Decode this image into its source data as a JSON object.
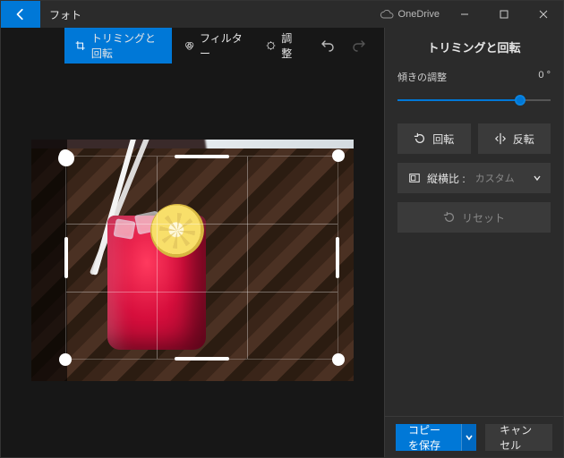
{
  "title": "フォト",
  "cloud": "OneDrive",
  "tabs": {
    "crop": {
      "label": "トリミングと回転"
    },
    "filter": {
      "label": "フィルター"
    },
    "adjust": {
      "label": "調整"
    }
  },
  "panel": {
    "title": "トリミングと回転",
    "straighten_label": "傾きの調整",
    "straighten_value": "0 °",
    "rotate_label": "回転",
    "flip_label": "反転",
    "aspect_label": "縦横比 :",
    "aspect_value": "カスタム",
    "reset_label": "リセット"
  },
  "footer": {
    "save": "コピーを保存",
    "cancel": "キャンセル"
  }
}
